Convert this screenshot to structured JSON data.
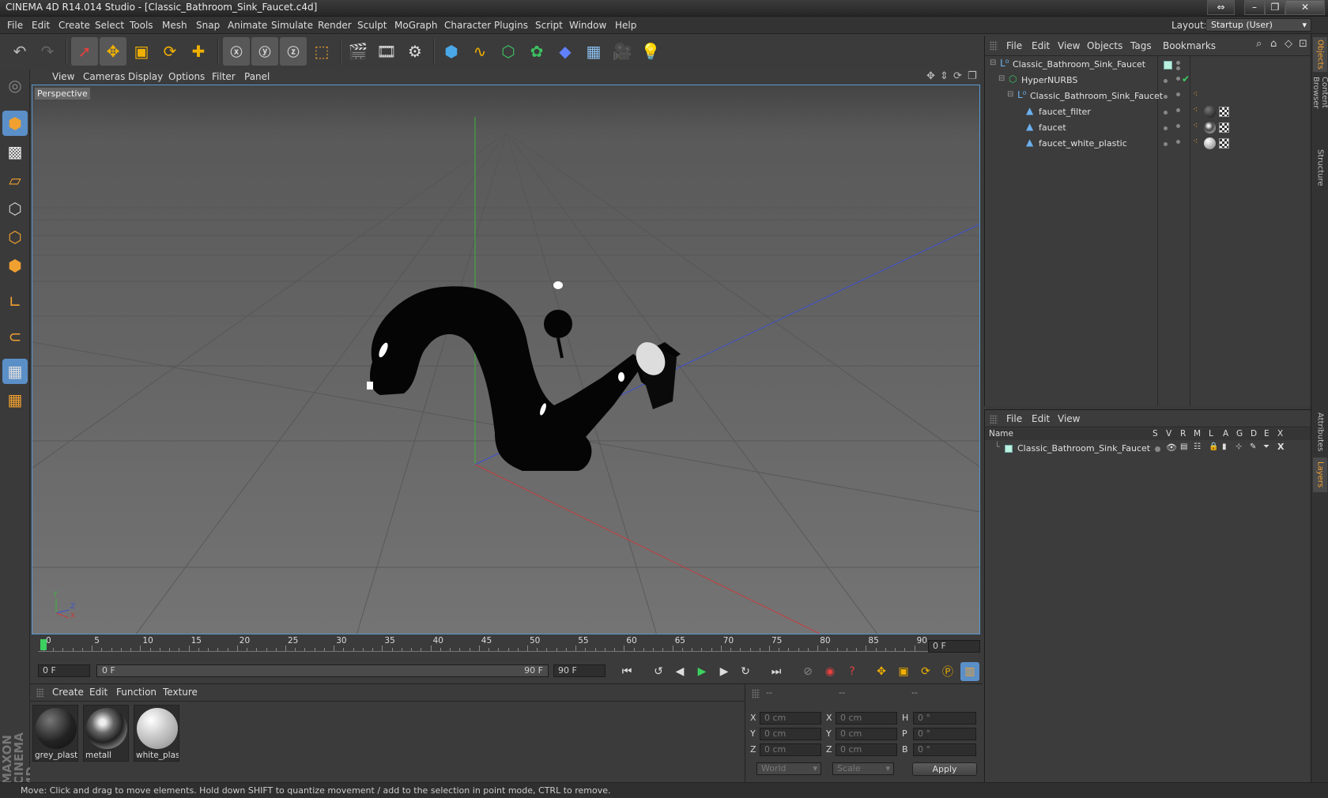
{
  "window": {
    "title": "CINEMA 4D R14.014 Studio - [Classic_Bathroom_Sink_Faucet.c4d]"
  },
  "menu": [
    "File",
    "Edit",
    "Create",
    "Select",
    "Tools",
    "Mesh",
    "Snap",
    "Animate",
    "Simulate",
    "Render",
    "Sculpt",
    "MoGraph",
    "Character",
    "Plugins",
    "Script",
    "Window",
    "Help"
  ],
  "layout": {
    "label": "Layout:",
    "value": "Startup (User)"
  },
  "viewport": {
    "menu": [
      "View",
      "Cameras",
      "Display",
      "Options",
      "Filter",
      "Panel"
    ],
    "label": "Perspective",
    "axis_labels": {
      "y": "Y",
      "z": "Z",
      "x": "X"
    }
  },
  "timeline": {
    "ticks": [
      "0",
      "5",
      "10",
      "15",
      "20",
      "25",
      "30",
      "35",
      "40",
      "45",
      "50",
      "55",
      "60",
      "65",
      "70",
      "75",
      "80",
      "85",
      "90"
    ],
    "current_frame": "0 F"
  },
  "transport": {
    "start": "0 F",
    "range_start": "0 F",
    "range_end": "90 F",
    "end": "90 F"
  },
  "materials": {
    "menu": [
      "Create",
      "Edit",
      "Function",
      "Texture"
    ],
    "items": [
      {
        "name": "grey_plasti"
      },
      {
        "name": "metall"
      },
      {
        "name": "white_plas"
      }
    ]
  },
  "coords": {
    "headers": [
      "--",
      "--",
      "--"
    ],
    "rows": [
      {
        "a": "X",
        "av": "0 cm",
        "b": "X",
        "bv": "0 cm",
        "c": "H",
        "cv": "0 °"
      },
      {
        "a": "Y",
        "av": "0 cm",
        "b": "Y",
        "bv": "0 cm",
        "c": "P",
        "cv": "0 °"
      },
      {
        "a": "Z",
        "av": "0 cm",
        "b": "Z",
        "bv": "0 cm",
        "c": "B",
        "cv": "0 °"
      }
    ],
    "mode1": "World",
    "mode2": "Scale",
    "apply": "Apply"
  },
  "object_manager": {
    "menu": [
      "File",
      "Edit",
      "View",
      "Objects",
      "Tags",
      "Bookmarks"
    ],
    "objects": [
      {
        "name": "Classic_Bathroom_Sink_Faucet"
      },
      {
        "name": "HyperNURBS"
      },
      {
        "name": "Classic_Bathroom_Sink_Faucet"
      },
      {
        "name": "faucet_filter"
      },
      {
        "name": "faucet"
      },
      {
        "name": "faucet_white_plastic"
      }
    ]
  },
  "layer_manager": {
    "menu": [
      "File",
      "Edit",
      "View"
    ],
    "columns": [
      "Name",
      "S",
      "V",
      "R",
      "M",
      "L",
      "A",
      "G",
      "D",
      "E",
      "X"
    ],
    "layers": [
      {
        "name": "Classic_Bathroom_Sink_Faucet",
        "color": "#b9f2de"
      }
    ]
  },
  "right_tabs": [
    "Objects",
    "Content Browser",
    "Structure",
    "Attributes",
    "Layers"
  ],
  "status": "Move: Click and drag to move elements. Hold down SHIFT to quantize movement / add to the selection in point mode, CTRL to remove.",
  "colors": {
    "accent": "#5a9ad5",
    "layer_green": "#b9f2de",
    "x_axis": "#c83c3c",
    "y_axis": "#3cb43c",
    "z_axis": "#3c50d2"
  }
}
